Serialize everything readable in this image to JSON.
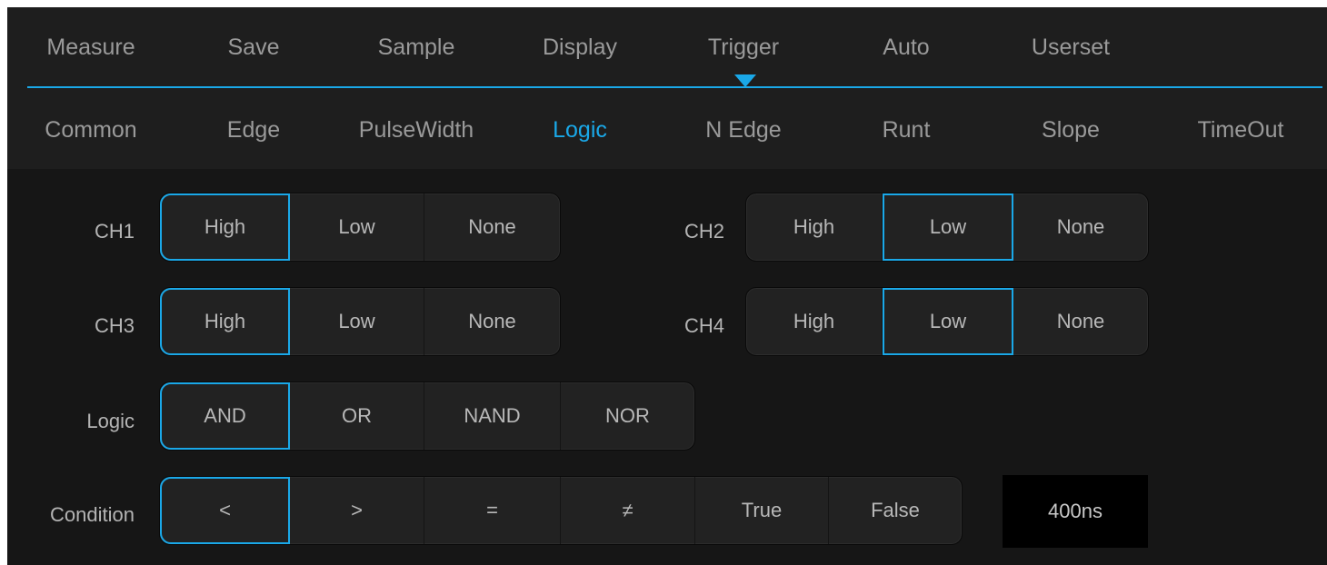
{
  "top_menu": {
    "tabs": [
      "Measure",
      "Save",
      "Sample",
      "Display",
      "Trigger",
      "Auto",
      "Userset"
    ],
    "active": "Trigger"
  },
  "trigger_types": {
    "tabs": [
      "Common",
      "Edge",
      "PulseWidth",
      "Logic",
      "N Edge",
      "Runt",
      "Slope",
      "TimeOut"
    ],
    "active": "Logic"
  },
  "channels": {
    "ch1": {
      "label": "CH1",
      "options": [
        "High",
        "Low",
        "None"
      ],
      "selected": "High"
    },
    "ch2": {
      "label": "CH2",
      "options": [
        "High",
        "Low",
        "None"
      ],
      "selected": "Low"
    },
    "ch3": {
      "label": "CH3",
      "options": [
        "High",
        "Low",
        "None"
      ],
      "selected": "High"
    },
    "ch4": {
      "label": "CH4",
      "options": [
        "High",
        "Low",
        "None"
      ],
      "selected": "Low"
    }
  },
  "logic": {
    "label": "Logic",
    "options": [
      "AND",
      "OR",
      "NAND",
      "NOR"
    ],
    "selected": "AND"
  },
  "condition": {
    "label": "Condition",
    "options": [
      "<",
      ">",
      "=",
      "≠",
      "True",
      "False"
    ],
    "selected": "<",
    "time_value": "400ns"
  },
  "colors": {
    "accent": "#1aa8e8",
    "background": "#161616",
    "menu_background": "#1e1e1e",
    "button_background": "#222222",
    "text": "#b8b8b8"
  }
}
